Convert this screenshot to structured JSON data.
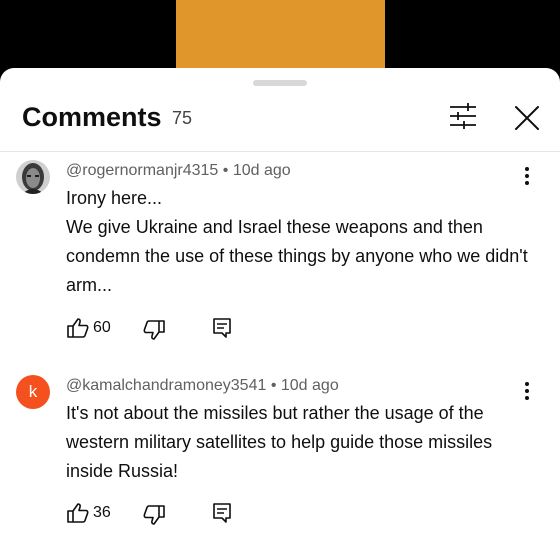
{
  "header": {
    "title": "Comments",
    "count": "75"
  },
  "comments": [
    {
      "author": "@rogernormanjr4315",
      "time": "10d ago",
      "separator": "•",
      "text": "Irony here...\nWe give Ukraine and Israel these weapons and then condemn the use of these things by anyone who we didn't arm...",
      "likes": "60",
      "avatar_icon": "photo-avatar-icon"
    },
    {
      "author": "@kamalchandramoney3541",
      "time": "10d ago",
      "separator": "•",
      "text": "It's not about the missiles but rather the usage of the western military satellites to help guide those missiles inside Russia!",
      "likes": "36",
      "avatar_letter": "k",
      "avatar_color": "#f4511e"
    }
  ],
  "colors": {
    "video_thumb": "#e0962a",
    "text_primary": "#0f0f0f",
    "text_secondary": "#606060"
  }
}
